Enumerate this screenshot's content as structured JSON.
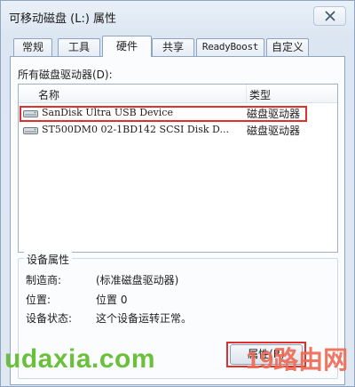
{
  "window": {
    "title": "可移动磁盘 (L:) 属性"
  },
  "tabs": [
    {
      "label": "常规"
    },
    {
      "label": "工具"
    },
    {
      "label": "硬件"
    },
    {
      "label": "共享"
    },
    {
      "label": "ReadyBoost"
    },
    {
      "label": "自定义"
    }
  ],
  "active_tab": "硬件",
  "devices_section": {
    "label": "所有磁盘驱动器(D):",
    "columns": {
      "name": "名称",
      "type": "类型"
    },
    "rows": [
      {
        "name": "SanDisk Ultra USB Device",
        "type": "磁盘驱动器",
        "selected": true
      },
      {
        "name": "ST500DM0 02-1BD142 SCSI Disk D...",
        "type": "磁盘驱动器",
        "selected": false
      }
    ]
  },
  "properties": {
    "title": "设备属性",
    "manufacturer_label": "制造商:",
    "manufacturer_value": "(标准磁盘驱动器)",
    "location_label": "位置:",
    "location_value": "位置 0",
    "status_label": "设备状态:",
    "status_value": "这个设备运转正常。",
    "button_label": "属性(R)"
  },
  "watermarks": {
    "left": "udaxia.com",
    "right": "19路由网"
  },
  "colors": {
    "highlight": "#e0302e",
    "watermark_left": "#69c03a",
    "watermark_right": "#ee6b55"
  },
  "icons": {
    "close": "close-icon",
    "drive": "drive-icon"
  }
}
